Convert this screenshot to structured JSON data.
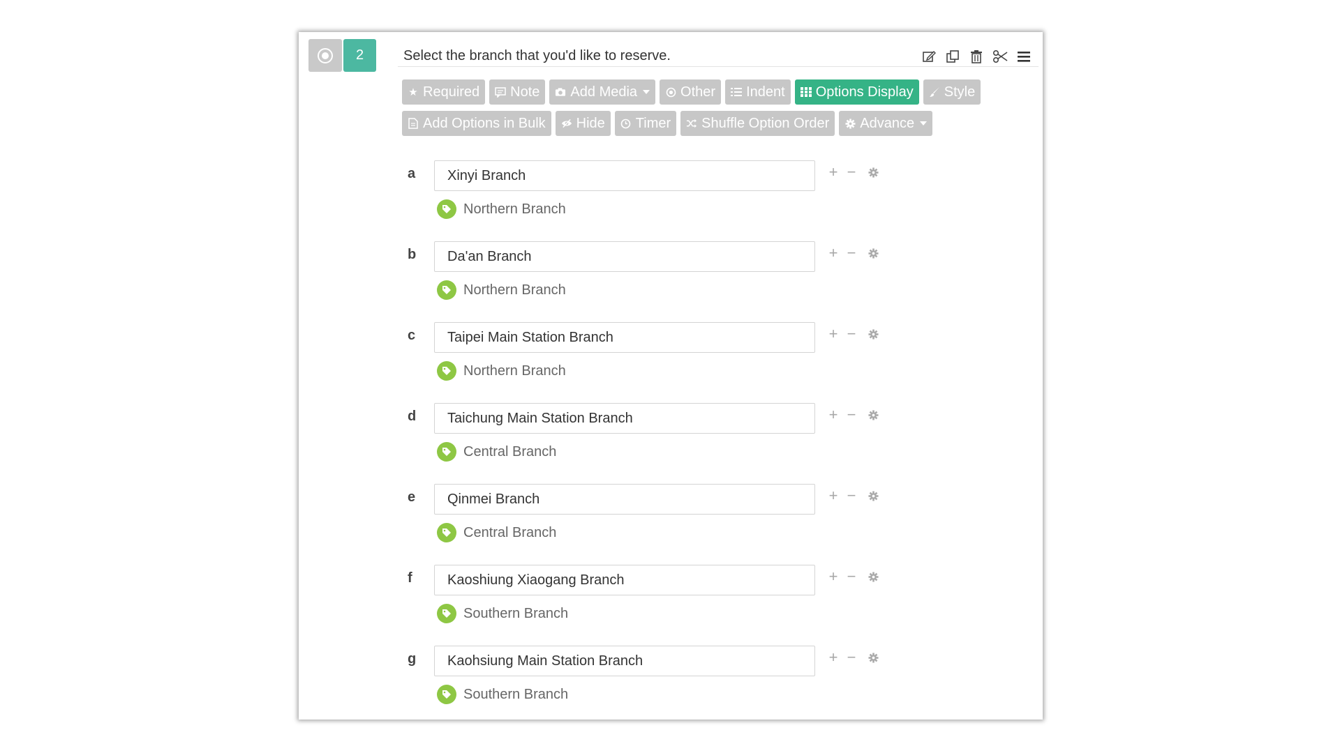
{
  "question": {
    "number": "2",
    "title": "Select the branch that you'd like to reserve."
  },
  "title_tools": [
    "edit-icon",
    "copy-icon",
    "trash-icon",
    "scissors-icon",
    "menu-icon"
  ],
  "toolbar": {
    "row1": [
      {
        "label": "Required",
        "icon": "star-icon"
      },
      {
        "label": "Note",
        "icon": "note-icon"
      },
      {
        "label": "Add Media",
        "icon": "camera-icon"
      },
      {
        "label": "Other",
        "icon": "radio-icon"
      },
      {
        "label": "Indent",
        "icon": "list-icon"
      },
      {
        "label": "Options Display",
        "icon": "grid-icon",
        "active": true
      },
      {
        "label": "Style",
        "icon": "brush-icon"
      }
    ],
    "row2": [
      {
        "label": "Add Options in Bulk",
        "icon": "document-icon"
      },
      {
        "label": "Hide",
        "icon": "eye-slash-icon"
      },
      {
        "label": "Timer",
        "icon": "clock-icon"
      },
      {
        "label": "Shuffle Option Order",
        "icon": "shuffle-icon"
      },
      {
        "label": "Advance",
        "icon": "gear-icon"
      }
    ]
  },
  "options": [
    {
      "letter": "a",
      "value": "Xinyi Branch",
      "tag": "Northern Branch"
    },
    {
      "letter": "b",
      "value": "Da'an Branch",
      "tag": "Northern Branch"
    },
    {
      "letter": "c",
      "value": "Taipei Main Station Branch",
      "tag": "Northern Branch"
    },
    {
      "letter": "d",
      "value": "Taichung Main Station Branch",
      "tag": "Central Branch"
    },
    {
      "letter": "e",
      "value": "Qinmei Branch",
      "tag": "Central Branch"
    },
    {
      "letter": "f",
      "value": "Kaoshiung Xiaogang Branch",
      "tag": "Southern Branch"
    },
    {
      "letter": "g",
      "value": "Kaohsiung Main Station Branch",
      "tag": "Southern Branch"
    }
  ],
  "colors": {
    "accent": "#35b386",
    "question_number_bg": "#4cb8a1",
    "button_gray": "#c7c7c7",
    "tag_green": "#8ec744"
  }
}
